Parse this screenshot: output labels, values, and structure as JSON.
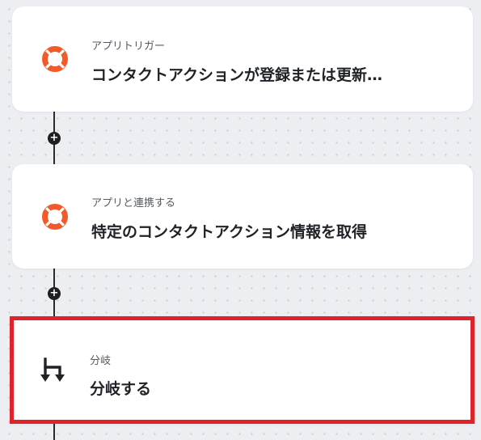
{
  "colors": {
    "accent_red": "#e0232b",
    "icon_orange": "#f25a2a",
    "line": "#2b2b2b"
  },
  "steps": [
    {
      "label": "アプリトリガー",
      "title": "コンタクトアクションが登録または更新…",
      "icon": "lifebuoy-icon"
    },
    {
      "label": "アプリと連携する",
      "title": "特定のコンタクトアクション情報を取得",
      "icon": "lifebuoy-icon"
    },
    {
      "label": "分岐",
      "title": "分岐する",
      "icon": "branch-icon",
      "selected": true
    }
  ],
  "add_button_symbol": "+"
}
